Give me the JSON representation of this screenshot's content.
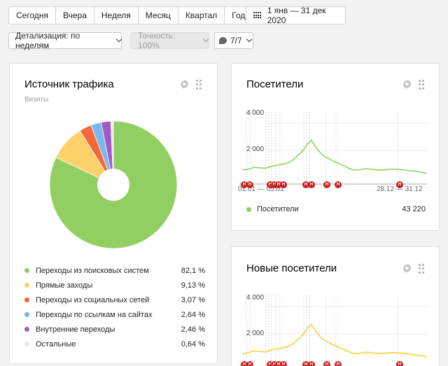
{
  "toolbar": {
    "periods": [
      "Сегодня",
      "Вчера",
      "Неделя",
      "Месяц",
      "Квартал",
      "Год"
    ],
    "date_range": "1 янв — 31 дек 2020"
  },
  "filters": {
    "detail": "Детализация: по неделям",
    "accuracy": "Точность: 100%",
    "segments": "7/7"
  },
  "traffic_card": {
    "title": "Источник трафика",
    "subtitle": "Визиты",
    "chart_data": {
      "type": "pie",
      "categories": [
        "Переходы из поисковых систем",
        "Прямые заходы",
        "Переходы из социальных сетей",
        "Переходы по ссылкам на сайтах",
        "Внутренние переходы",
        "Остальные"
      ],
      "values": [
        82.1,
        9.13,
        3.07,
        2.64,
        2.46,
        0.64
      ],
      "labels": [
        "82,1 %",
        "9,13 %",
        "3,07 %",
        "2,64 %",
        "2,46 %",
        "0,64 %"
      ],
      "colors": [
        "#92cf62",
        "#fcd16a",
        "#f5683b",
        "#7ab8ec",
        "#a25bc3",
        "#ebebeb"
      ],
      "donut": true
    }
  },
  "visitors_card": {
    "title": "Посетители",
    "total": "43 220",
    "chart_data": {
      "type": "line",
      "series": [
        {
          "name": "Посетители",
          "color": "#92cf62",
          "values": [
            620,
            640,
            700,
            800,
            780,
            760,
            740,
            820,
            900,
            960,
            1000,
            1050,
            1150,
            1300,
            1550,
            1800,
            2100,
            2500,
            2750,
            2300,
            1950,
            1650,
            1500,
            1350,
            1200,
            1100,
            950,
            850,
            700,
            620,
            600,
            650,
            700,
            680,
            650,
            620,
            600,
            600,
            650,
            680,
            660,
            640,
            620,
            580,
            550,
            520,
            480,
            420,
            360
          ]
        }
      ],
      "y_ticks": [
        "4 000",
        "2 000"
      ],
      "ylim": [
        0,
        4600
      ],
      "x_ticks": [
        "01.01 — 05.01",
        "28.12 — 31.12"
      ]
    }
  },
  "new_visitors_card": {
    "title": "Новые посетители",
    "chart_data": {
      "type": "line",
      "series": [
        {
          "name": "Новые посетители",
          "color": "#f7d139",
          "values": [
            600,
            620,
            680,
            780,
            760,
            740,
            720,
            800,
            880,
            940,
            980,
            1030,
            1120,
            1260,
            1500,
            1740,
            2050,
            2450,
            2700,
            2260,
            1900,
            1620,
            1470,
            1320,
            1180,
            1080,
            930,
            830,
            690,
            610,
            590,
            640,
            690,
            670,
            640,
            610,
            590,
            590,
            640,
            670,
            650,
            630,
            610,
            570,
            540,
            510,
            470,
            410,
            350
          ]
        }
      ],
      "y_ticks": [
        "4 000",
        "2 000"
      ],
      "ylim": [
        0,
        4600
      ]
    }
  },
  "holiday_marker": "Н",
  "colors": {
    "accent_red": "#c81e1e",
    "grid": "#ececec"
  },
  "icons": [
    "calendar-icon",
    "chevron-down-icon",
    "comment-icon",
    "gear-icon",
    "drag-handle-icon"
  ]
}
